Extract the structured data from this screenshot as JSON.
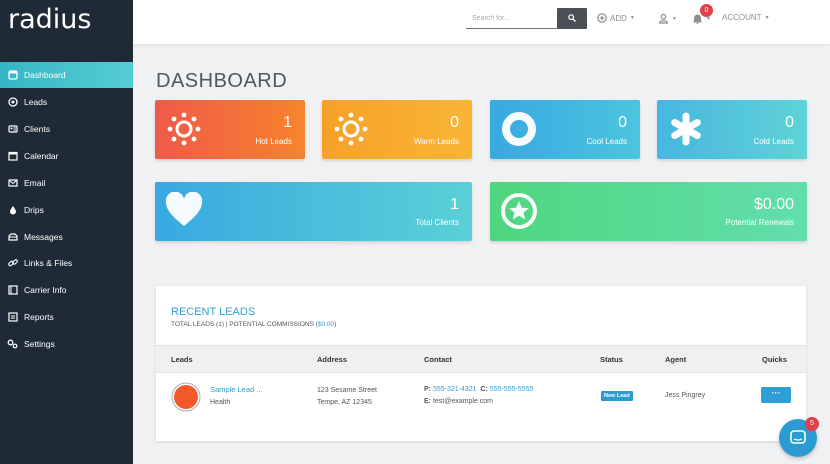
{
  "brand": {
    "logo": "radius"
  },
  "sidebar": {
    "items": [
      {
        "label": "Dashboard",
        "icon": "dashboard-icon"
      },
      {
        "label": "Leads",
        "icon": "leads-icon"
      },
      {
        "label": "Clients",
        "icon": "clients-icon"
      },
      {
        "label": "Calendar",
        "icon": "calendar-icon"
      },
      {
        "label": "Email",
        "icon": "email-icon"
      },
      {
        "label": "Drips",
        "icon": "drip-icon"
      },
      {
        "label": "Messages",
        "icon": "messages-icon"
      },
      {
        "label": "Links & Files",
        "icon": "link-icon"
      },
      {
        "label": "Carrier Info",
        "icon": "carrier-icon"
      },
      {
        "label": "Reports",
        "icon": "reports-icon"
      },
      {
        "label": "Settings",
        "icon": "settings-icon"
      }
    ]
  },
  "topbar": {
    "search_placeholder": "Search for...",
    "add_label": "ADD",
    "notifications_count": "0",
    "account_label": "ACCOUNT"
  },
  "page": {
    "title": "DASHBOARD"
  },
  "cards": {
    "hot": {
      "value": "1",
      "label": "Hot Leads"
    },
    "warm": {
      "value": "0",
      "label": "Warm Leads"
    },
    "cool": {
      "value": "0",
      "label": "Cool Leads"
    },
    "cold": {
      "value": "0",
      "label": "Cold Leads"
    },
    "clients": {
      "value": "1",
      "label": "Total Clients"
    },
    "renewals": {
      "value": "$0.00",
      "label": "Potential Renewals"
    }
  },
  "recent_leads": {
    "title": "RECENT LEADS",
    "subtitle_prefix": "TOTAL LEADS (1) | POTENTIAL COMMISSIONS (",
    "subtitle_value": "$0.00",
    "subtitle_suffix": ")",
    "columns": {
      "leads": "Leads",
      "address": "Address",
      "contact": "Contact",
      "status": "Status",
      "agent": "Agent",
      "quicks": "Quicks"
    },
    "rows": [
      {
        "name": "Sample Lead ...",
        "type": "Health",
        "address1": "123 Sesame Street",
        "address2": "Tempe, AZ 12345",
        "phone_label": "P:",
        "phone": "555-321-4321",
        "cell_label": "C:",
        "cell": "555-555-5555",
        "email_label": "E:",
        "email": "test@example.com",
        "status": "New Lead",
        "agent": "Jess Pingrey",
        "quick": "···"
      }
    ]
  },
  "chat": {
    "badge": "5"
  },
  "colors": {
    "sidebar": "#1e2b36",
    "active": "#35b6c5",
    "link": "#2e9fd6",
    "hot": "#f25c40",
    "warm": "#f7a928",
    "cool": "#3daee0",
    "cold": "#55c4d8",
    "green": "#4fd88b"
  }
}
